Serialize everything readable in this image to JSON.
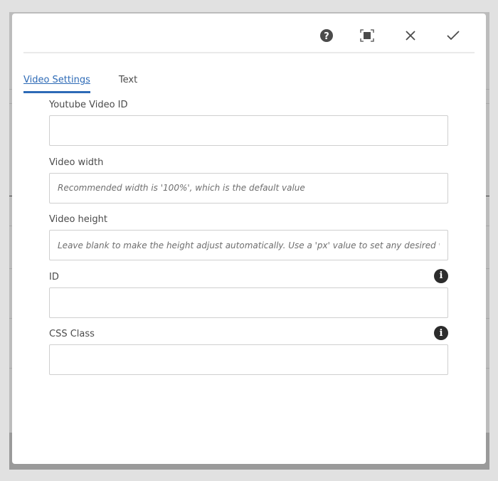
{
  "toolbar": {
    "help": "help-icon",
    "fullscreen": "fullscreen-icon",
    "close": "close-icon",
    "done": "check-icon"
  },
  "tabs": [
    {
      "label": "Video Settings",
      "active": true
    },
    {
      "label": "Text",
      "active": false
    }
  ],
  "fields": [
    {
      "label": "Youtube Video ID",
      "placeholder": "",
      "value": ""
    },
    {
      "label": "Video width",
      "placeholder": "Recommended width is '100%', which is the default value",
      "value": ""
    },
    {
      "label": "Video height",
      "placeholder": "Leave blank to make the height adjust automatically. Use a 'px' value to set any desired value.",
      "value": ""
    },
    {
      "label": "ID",
      "placeholder": "",
      "value": "",
      "info": "i"
    },
    {
      "label": "CSS Class",
      "placeholder": "",
      "value": "",
      "info": "i"
    }
  ]
}
